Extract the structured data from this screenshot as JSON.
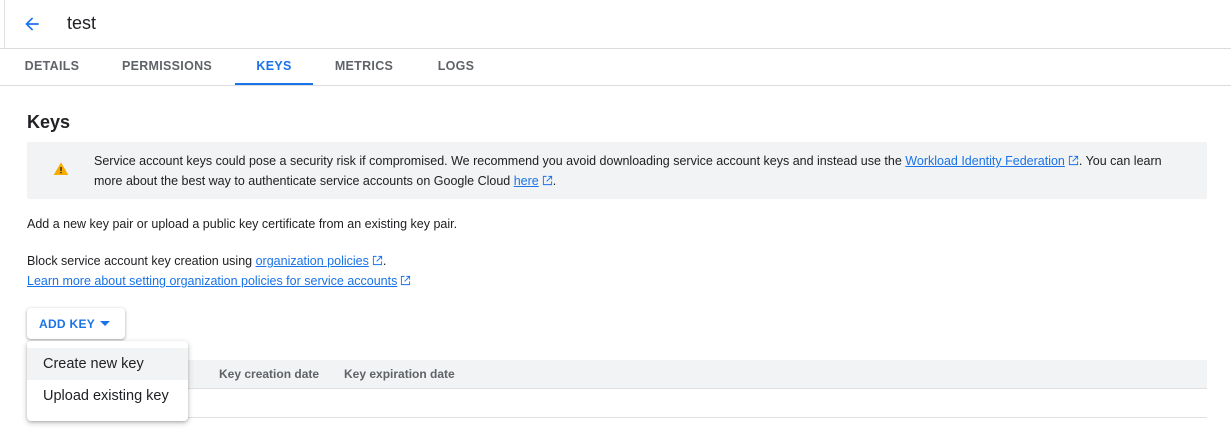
{
  "header": {
    "title": "test",
    "back_icon": "arrow-back-icon"
  },
  "tabs": [
    {
      "label": "DETAILS",
      "active": false
    },
    {
      "label": "PERMISSIONS",
      "active": false
    },
    {
      "label": "KEYS",
      "active": true
    },
    {
      "label": "METRICS",
      "active": false
    },
    {
      "label": "LOGS",
      "active": false
    }
  ],
  "keys": {
    "title": "Keys",
    "banner": {
      "icon": "warning-icon",
      "text_1": "Service account keys could pose a security risk if compromised. We recommend you avoid downloading service account keys and instead use the ",
      "link_1": "Workload Identity Federation",
      "text_2": ". You can learn more about the best way to authenticate service accounts on Google Cloud ",
      "link_2": "here",
      "text_3": "."
    },
    "intro": "Add a new key pair or upload a public key certificate from an existing key pair.",
    "block_text": "Block service account key creation using ",
    "block_link": "organization policies",
    "block_end": ".",
    "learn_more_link": "Learn more about setting organization policies for service accounts",
    "add_key_label": "ADD KEY",
    "menu_items": [
      "Create new key",
      "Upload existing key"
    ],
    "table_headers": [
      "Key creation date",
      "Key expiration date"
    ]
  },
  "colors": {
    "accent": "#1a73e8",
    "warning": "#f9ab00",
    "banner_bg": "#f1f3f4"
  }
}
